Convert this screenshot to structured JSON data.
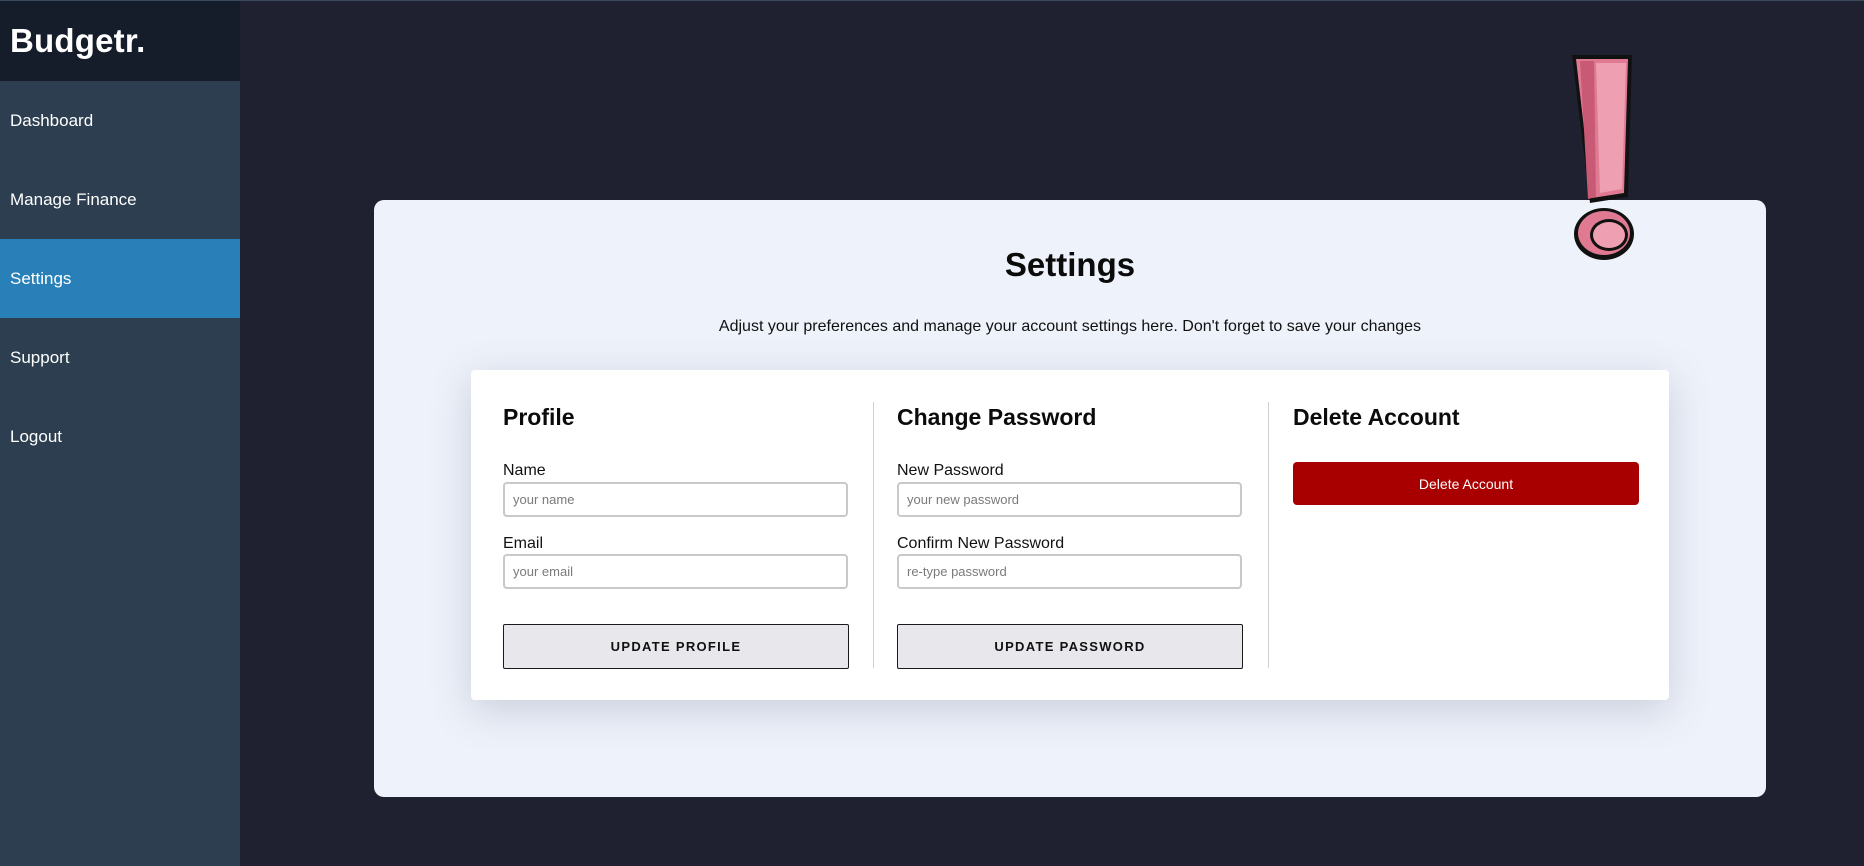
{
  "app": {
    "brand": "Budgetr."
  },
  "sidebar": {
    "items": [
      {
        "label": "Dashboard"
      },
      {
        "label": "Manage Finance"
      },
      {
        "label": "Settings"
      },
      {
        "label": "Support"
      },
      {
        "label": "Logout"
      }
    ],
    "active": "Settings"
  },
  "settings": {
    "title": "Settings",
    "subtitle": "Adjust your preferences and manage your account settings here. Don't forget to save your changes"
  },
  "profile": {
    "title": "Profile",
    "name_label": "Name",
    "name_placeholder": "your name",
    "name_value": "",
    "email_label": "Email",
    "email_placeholder": "your email",
    "email_value": "",
    "button": "UPDATE PROFILE"
  },
  "password": {
    "title": "Change Password",
    "new_label": "New Password",
    "new_placeholder": "your new password",
    "confirm_label": "Confirm New Password",
    "confirm_placeholder": "re-type password",
    "button": "UPDATE PASSWORD"
  },
  "delete": {
    "title": "Delete Account",
    "button": "Delete Account"
  },
  "icons": {
    "decoration": "exclamation-icon"
  },
  "colors": {
    "sidebar_bg": "#2c3e50",
    "brand_bg": "#161d2a",
    "active_nav": "#2980b9",
    "page_bg": "#1f2130",
    "panel_bg": "#eef2fa",
    "danger": "#a80000",
    "exclamation": "#e07a93"
  }
}
